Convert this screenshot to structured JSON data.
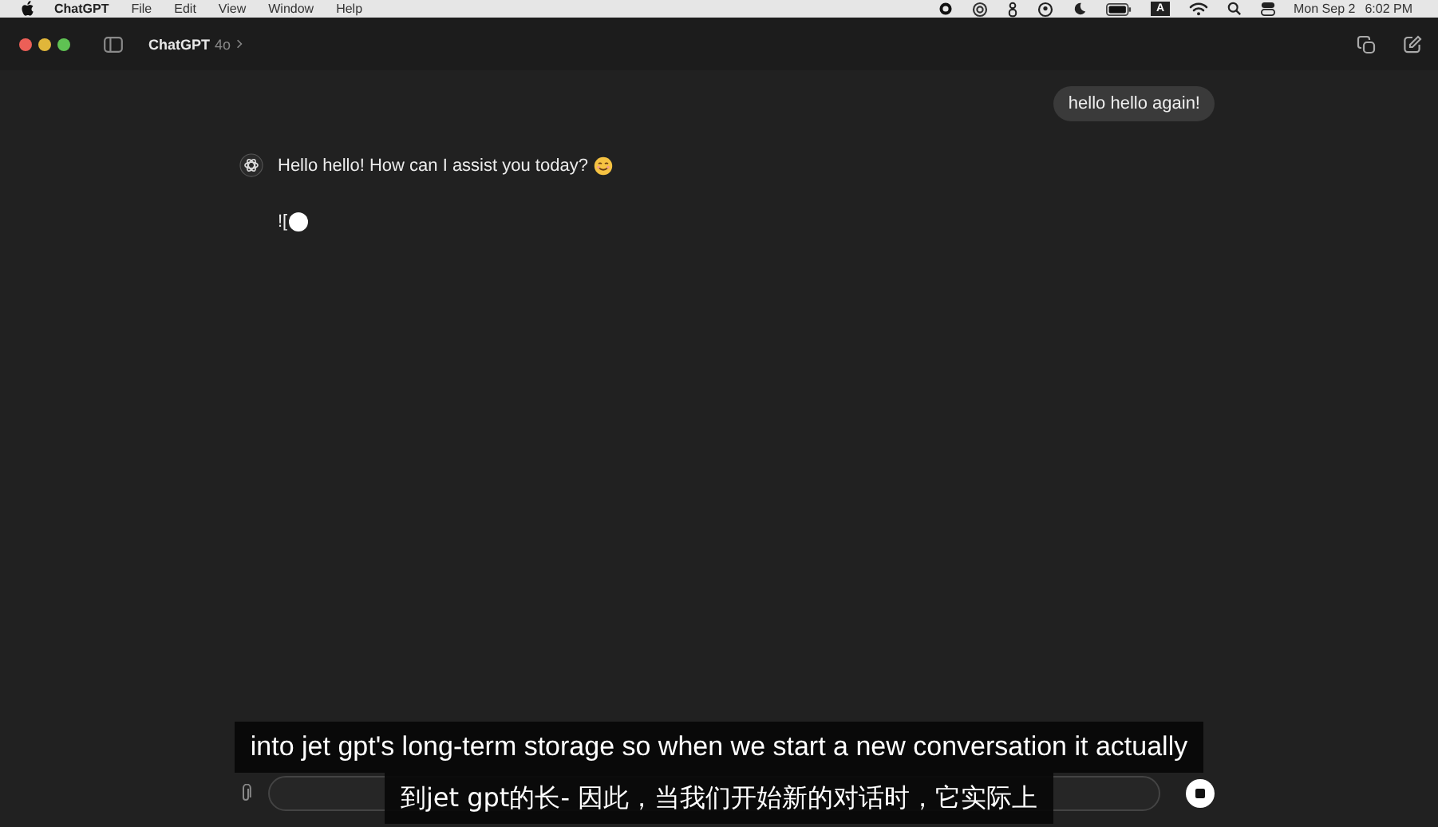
{
  "menu_bar": {
    "app": "ChatGPT",
    "items": [
      "File",
      "Edit",
      "View",
      "Window",
      "Help"
    ],
    "input_source": "A",
    "date": "Mon Sep 2",
    "time": "6:02 PM"
  },
  "window": {
    "title": "ChatGPT",
    "model": "4o"
  },
  "messages": [
    {
      "kind": "user",
      "text": "hello hello again!"
    },
    {
      "kind": "assistant",
      "text": "Hello hello! How can I assist you today?",
      "emoji": true
    },
    {
      "kind": "assistant",
      "text": "![",
      "streaming": true
    }
  ],
  "subtitles": [
    "into jet gpt's long-term storage so when we start a new conversation it actually",
    "到jet gpt的长- 因此，当我们开始新的对话时，它实际上"
  ]
}
